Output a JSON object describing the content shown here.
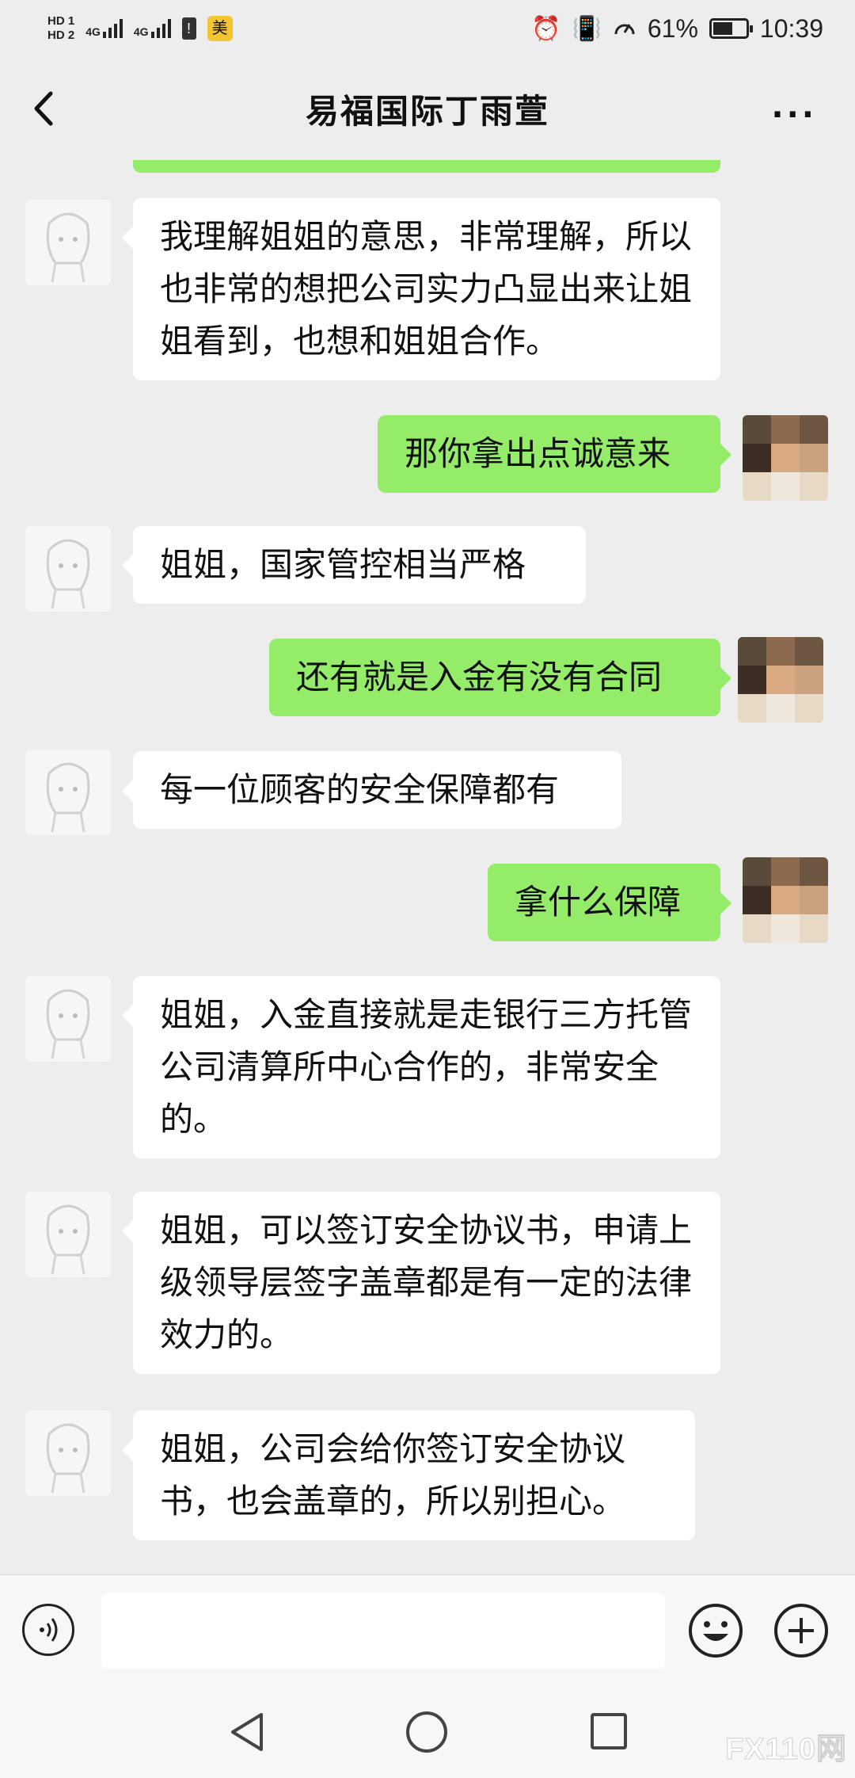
{
  "status_bar": {
    "hd1": "HD 1",
    "hd2": "HD 2",
    "net1": "4G",
    "net2": "4G",
    "mei_badge": "美",
    "battery_percent": "61%",
    "battery_level": 0.61,
    "time": "10:39",
    "icons": [
      "alarm-icon",
      "vibrate-icon",
      "speed-icon",
      "battery-icon",
      "alert-icon"
    ]
  },
  "header": {
    "title": "易福国际丁雨萱",
    "more_label": "···"
  },
  "messages": [
    {
      "side": "in",
      "text": "我理解姐姐的意思，非常理解，所以也非常的想把公司实力凸显出来让姐姐看到，也想和姐姐合作。"
    },
    {
      "side": "out",
      "text": "那你拿出点诚意来"
    },
    {
      "side": "in",
      "text": "姐姐，国家管控相当严格"
    },
    {
      "side": "out",
      "text": "还有就是入金有没有合同"
    },
    {
      "side": "in",
      "text": "每一位顾客的安全保障都有"
    },
    {
      "side": "out",
      "text": "拿什么保障"
    },
    {
      "side": "in",
      "text": "姐姐，入金直接就是走银行三方托管公司清算所中心合作的，非常安全的。"
    },
    {
      "side": "in",
      "text": "姐姐，可以签订安全协议书，申请上级领导层签字盖章都是有一定的法律效力的。"
    },
    {
      "side": "in",
      "text": "姐姐，公司会给你签订安全协议书，也会盖章的，所以别担心。"
    }
  ],
  "input_bar": {
    "value": "",
    "icons": [
      "voice-icon",
      "emoji-icon",
      "plus-icon"
    ]
  },
  "watermark": "FX110网",
  "colors": {
    "background": "#ededed",
    "incoming_bubble": "#ffffff",
    "outgoing_bubble": "#95ec69"
  }
}
